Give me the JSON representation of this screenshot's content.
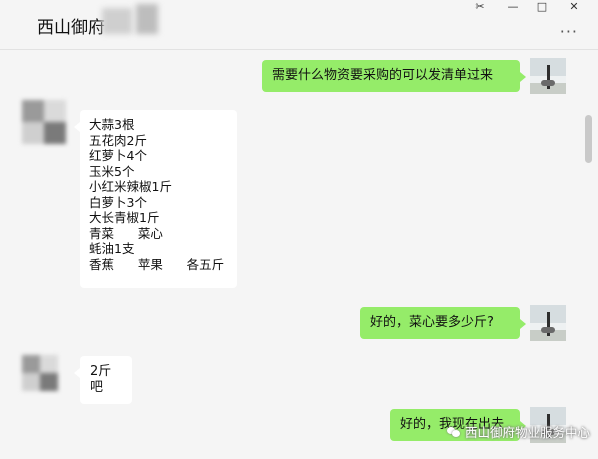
{
  "window": {
    "title": "西山御府",
    "controls": {
      "pin": "✂",
      "minimize": "—",
      "maximize": "□",
      "close": "✕"
    },
    "more": "···"
  },
  "messages": [
    {
      "from": "self",
      "text": "需要什么物资要采购的可以发清单过来"
    },
    {
      "from": "other",
      "lines": [
        "大蒜3根",
        "五花肉2斤",
        "红萝卜4个",
        "玉米5个",
        "小红米辣椒1斤",
        "白萝卜3个",
        "大长青椒1斤",
        "青菜      菜心",
        "蚝油1支",
        "香蕉      苹果      各五斤"
      ]
    },
    {
      "from": "self",
      "text": "好的，菜心要多少斤?"
    },
    {
      "from": "other",
      "text": "2斤吧"
    },
    {
      "from": "self",
      "text": "好的，我现在出去"
    }
  ],
  "watermark": {
    "text": "西山御府物业服务中心"
  },
  "colors": {
    "out_bubble": "#95ec69",
    "in_bubble": "#ffffff",
    "background": "#f5f5f5"
  }
}
